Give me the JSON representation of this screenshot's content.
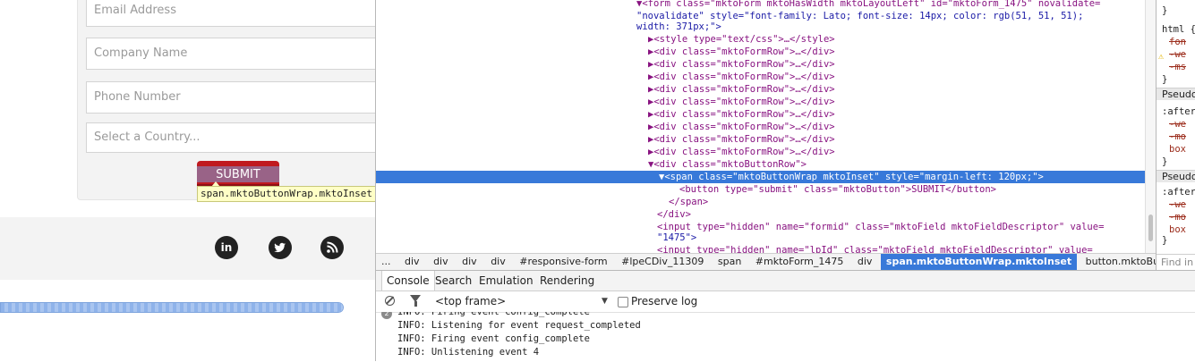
{
  "page": {
    "form": {
      "email_placeholder": "Email Address",
      "company_placeholder": "Company Name",
      "phone_placeholder": "Phone Number",
      "country_placeholder": "Select a Country...",
      "submit_label": "SUBMIT",
      "tooltip": "span.mktoButtonWrap.mktoInset"
    },
    "social": {
      "linkedin": "in",
      "twitter": "twitter-icon",
      "rss": "rss-icon"
    }
  },
  "elements_panel": {
    "lines": [
      {
        "tag_open": "<form ",
        "attrs": [
          [
            "class",
            "mktoForm mktoHasWidth mktoLayoutLeft"
          ],
          [
            "id",
            "mktoForm_1475"
          ],
          [
            "novalidate",
            ""
          ]
        ],
        "text": ""
      },
      {
        "raw": "\"novalidate\" style=\"font-family: Lato; font-size: 14px; color: rgb(51, 51, 51);"
      },
      {
        "raw": "width: 371px;\">"
      },
      {
        "collapsed": "<style type=\"text/css\">…</style>"
      },
      {
        "collapsed": "<div class=\"mktoFormRow\">…</div>"
      },
      {
        "collapsed": "<div class=\"mktoFormRow\">…</div>"
      },
      {
        "collapsed": "<div class=\"mktoFormRow\">…</div>"
      },
      {
        "collapsed": "<div class=\"mktoFormRow\">…</div>"
      },
      {
        "collapsed": "<div class=\"mktoFormRow\">…</div>"
      },
      {
        "collapsed": "<div class=\"mktoFormRow\">…</div>"
      },
      {
        "collapsed": "<div class=\"mktoFormRow\">…</div>"
      },
      {
        "collapsed": "<div class=\"mktoFormRow\">…</div>"
      },
      {
        "collapsed": "<div class=\"mktoFormRow\">…</div>"
      },
      {
        "expanded": "<div class=\"mktoButtonRow\">"
      },
      {
        "selected": "<span class=\"mktoButtonWrap mktoInset\" style=\"margin-left: 120px;\">"
      },
      {
        "child": "<button type=\"submit\" class=\"mktoButton\">SUBMIT</button>"
      },
      {
        "close": "</span>"
      },
      {
        "close2": "</div>"
      },
      {
        "input1": "<input type=\"hidden\" name=\"formid\" class=\"mktoField mktoFieldDescriptor\" value="
      },
      {
        "input1b": "\"1475\">"
      },
      {
        "input2": "<input type=\"hidden\" name=\"lpId\" class=\"mktoField mktoFieldDescriptor\" value="
      }
    ],
    "line_text": [
      "▼<form class=\"mktoForm mktoHasWidth mktoLayoutLeft\" id=\"mktoForm_1475\" novalidate=",
      "\"novalidate\" style=\"font-family: Lato; font-size: 14px; color: rgb(51, 51, 51);",
      "width: 371px;\">",
      "▶<style type=\"text/css\">…</style>",
      "▶<div class=\"mktoFormRow\">…</div>",
      "▶<div class=\"mktoFormRow\">…</div>",
      "▶<div class=\"mktoFormRow\">…</div>",
      "▶<div class=\"mktoFormRow\">…</div>",
      "▶<div class=\"mktoFormRow\">…</div>",
      "▶<div class=\"mktoFormRow\">…</div>",
      "▶<div class=\"mktoFormRow\">…</div>",
      "▶<div class=\"mktoFormRow\">…</div>",
      "▶<div class=\"mktoFormRow\">…</div>",
      "▼<div class=\"mktoButtonRow\">",
      "▼<span class=\"mktoButtonWrap mktoInset\" style=\"margin-left: 120px;\">",
      "<button type=\"submit\" class=\"mktoButton\">SUBMIT</button>",
      "</span>",
      "</div>",
      "<input type=\"hidden\" name=\"formid\" class=\"mktoField mktoFieldDescriptor\" value=",
      "\"1475\">",
      "<input type=\"hidden\" name=\"lpId\" class=\"mktoField mktoFieldDescriptor\" value="
    ]
  },
  "breadcrumb": [
    "...",
    "div",
    "div",
    "div",
    "div",
    "#responsive-form",
    "#lpeCDiv_11309",
    "span",
    "#mktoForm_1475",
    "div",
    "span.mktoButtonWrap.mktoInset",
    "button.mktoButton"
  ],
  "breadcrumb_active": "span.mktoButtonWrap.mktoInset",
  "styles_panel": {
    "lines": [
      "}",
      "html {",
      "fon",
      "-we",
      "-ms",
      "}",
      "Pseudo",
      ":after",
      "-we",
      "-mo",
      "box",
      "}",
      "Pseudo",
      ":after",
      "-we",
      "-mo",
      "box",
      "}"
    ],
    "find": "Find in"
  },
  "drawer": {
    "tabs": [
      "Console",
      "Search",
      "Emulation",
      "Rendering"
    ],
    "active_tab": "Console",
    "frame": "<top frame>",
    "preserve_log": "Preserve log",
    "badge": "2",
    "log": [
      "INFO: Firing event config_complete",
      "INFO: Listening for event request_completed",
      "INFO: Firing event config_complete",
      "INFO: Unlistening event 4"
    ]
  },
  "colors": {
    "selection": "#3879d9",
    "submit": "#c0191f",
    "tag": "#881280",
    "attr_name": "#994500",
    "attr_value": "#1a1aa6"
  }
}
